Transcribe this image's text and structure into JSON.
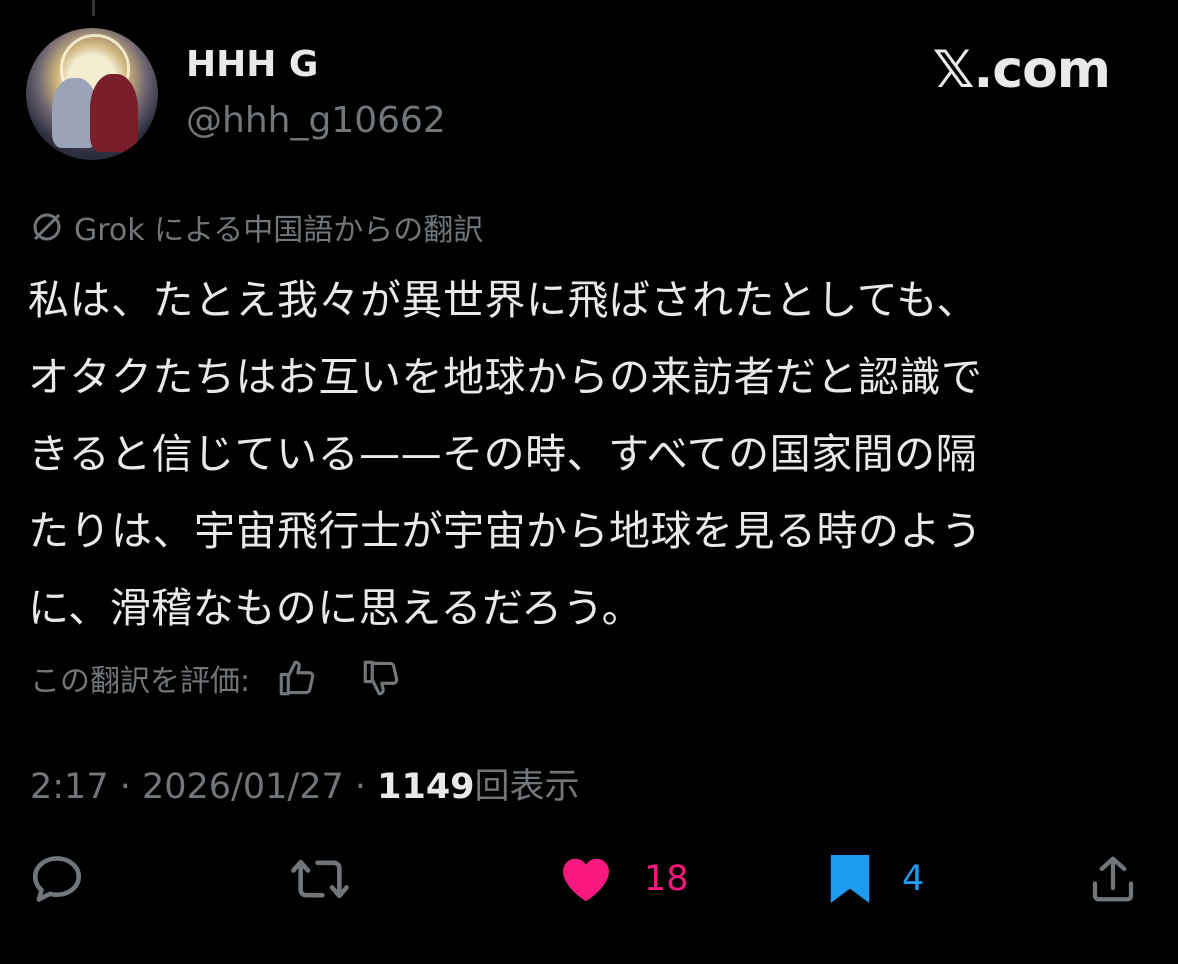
{
  "brand": "𝕏.com",
  "user": {
    "display_name": "HHH G",
    "handle": "@hhh_g10662"
  },
  "translation": {
    "note": "Grok による中国語からの翻訳"
  },
  "post": {
    "lines": [
      "私は、たとえ我々が異世界に飛ばされたとしても、",
      "オタクたちはお互いを地球からの来訪者だと認識で",
      "きると信じている——その時、すべての国家間の隔",
      "たりは、宇宙飛行士が宇宙から地球を見る時のよう",
      "に、滑稽なものに思えるだろう。"
    ]
  },
  "rating": {
    "label": "この翻訳を評価:"
  },
  "meta": {
    "time": "2:17",
    "separator": " · ",
    "date": "2026/01/27",
    "views": "1149",
    "views_label": "回表示"
  },
  "actions": {
    "reply": {
      "count": ""
    },
    "repost": {
      "count": ""
    },
    "like": {
      "count": "18",
      "color": "#f91880"
    },
    "bookmark": {
      "count": "4",
      "color": "#1d9bf0"
    },
    "share": {
      "count": ""
    }
  },
  "icons": [
    "reply-icon",
    "repost-icon",
    "like-icon",
    "bookmark-icon",
    "share-icon",
    "thumbs-up-icon",
    "thumbs-down-icon",
    "grok-icon"
  ]
}
